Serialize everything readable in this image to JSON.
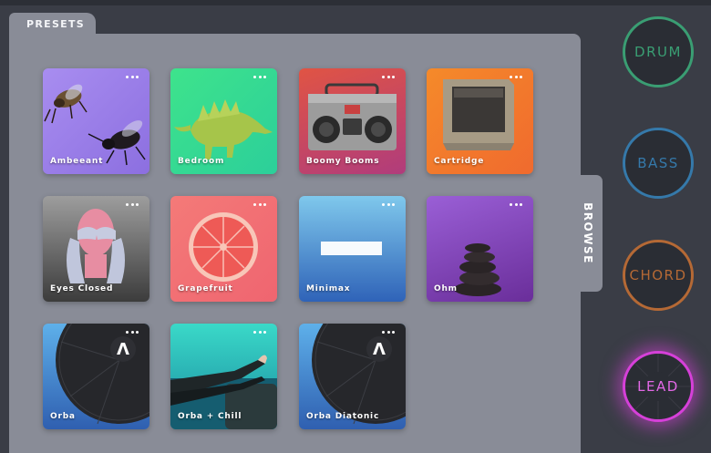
{
  "tabs": {
    "presets": "PRESETS",
    "browse": "BROWSE"
  },
  "presets": [
    {
      "label": "Ambeeant",
      "art": "bees"
    },
    {
      "label": "Bedroom",
      "art": "dinosaur"
    },
    {
      "label": "Boomy Booms",
      "art": "boombox"
    },
    {
      "label": "Cartridge",
      "art": "cartridge"
    },
    {
      "label": "Eyes Closed",
      "art": "covered-eyes"
    },
    {
      "label": "Grapefruit",
      "art": "grapefruit"
    },
    {
      "label": "Minimax",
      "art": "white-bar"
    },
    {
      "label": "Ohm",
      "art": "stacked-stones"
    },
    {
      "label": "Orba",
      "art": "orba-device"
    },
    {
      "label": "Orba + Chill",
      "art": "legs-on-couch"
    },
    {
      "label": "Orba Diatonic",
      "art": "orba-device"
    }
  ],
  "modes": [
    {
      "label": "DRUM",
      "color": "#3a9e73",
      "active": false
    },
    {
      "label": "BASS",
      "color": "#3579aa",
      "active": false
    },
    {
      "label": "CHORD",
      "color": "#b56935",
      "active": false
    },
    {
      "label": "LEAD",
      "color": "#d640d9",
      "active": true
    }
  ]
}
